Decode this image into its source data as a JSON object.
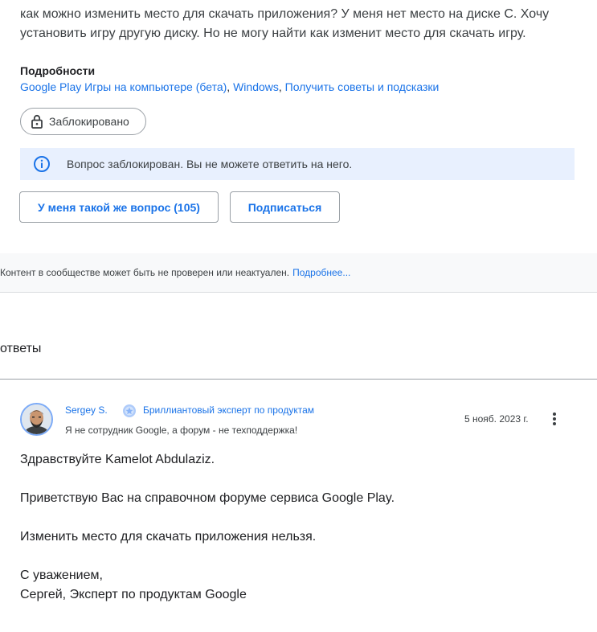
{
  "question": {
    "body": "как можно изменить место для скачать приложения? У меня нет место на диске C. Хочу установить игру другую диску. Но не могу найти как изменит место для скачать игру."
  },
  "details": {
    "heading": "Подробности",
    "links": [
      "Google Play Игры на компьютере (бета)",
      "Windows",
      "Получить советы и подсказки"
    ],
    "separator": ", "
  },
  "status_chip": {
    "label": "Заблокировано",
    "icon": "lock-icon"
  },
  "banner": {
    "text": "Вопрос заблокирован. Вы не можете ответить на него.",
    "icon": "info-icon"
  },
  "actions": {
    "same_question_label": "У меня такой же вопрос (105)",
    "subscribe_label": "Подписаться"
  },
  "disclaimer": {
    "text": "Контент в сообществе может быть не проверен или неактуален.",
    "link": "Подробнее..."
  },
  "answers": {
    "heading": "ответы",
    "items": [
      {
        "author": "Sergey S.",
        "badge_icon": "diamond-expert-badge-icon",
        "title": "Бриллиантовый эксперт по продуктам",
        "note": "Я не сотрудник Google, а форум - не техподдержка!",
        "date": "5 нояб. 2023 г.",
        "menu_icon": "more-vertical-icon",
        "lines": [
          "Здравствуйте Kamelot Abdulaziz.",
          "Приветствую Вас на справочном форуме сервиса Google Play.",
          "Изменить место для скачать приложения нельзя.",
          "С уважением,",
          "Сергей, Эксперт по продуктам Google"
        ]
      }
    ]
  },
  "colors": {
    "link": "#1a73e8",
    "banner_bg": "#e8f0fe",
    "text": "#202124",
    "muted": "#3c4043",
    "border": "#9aa0a6"
  }
}
